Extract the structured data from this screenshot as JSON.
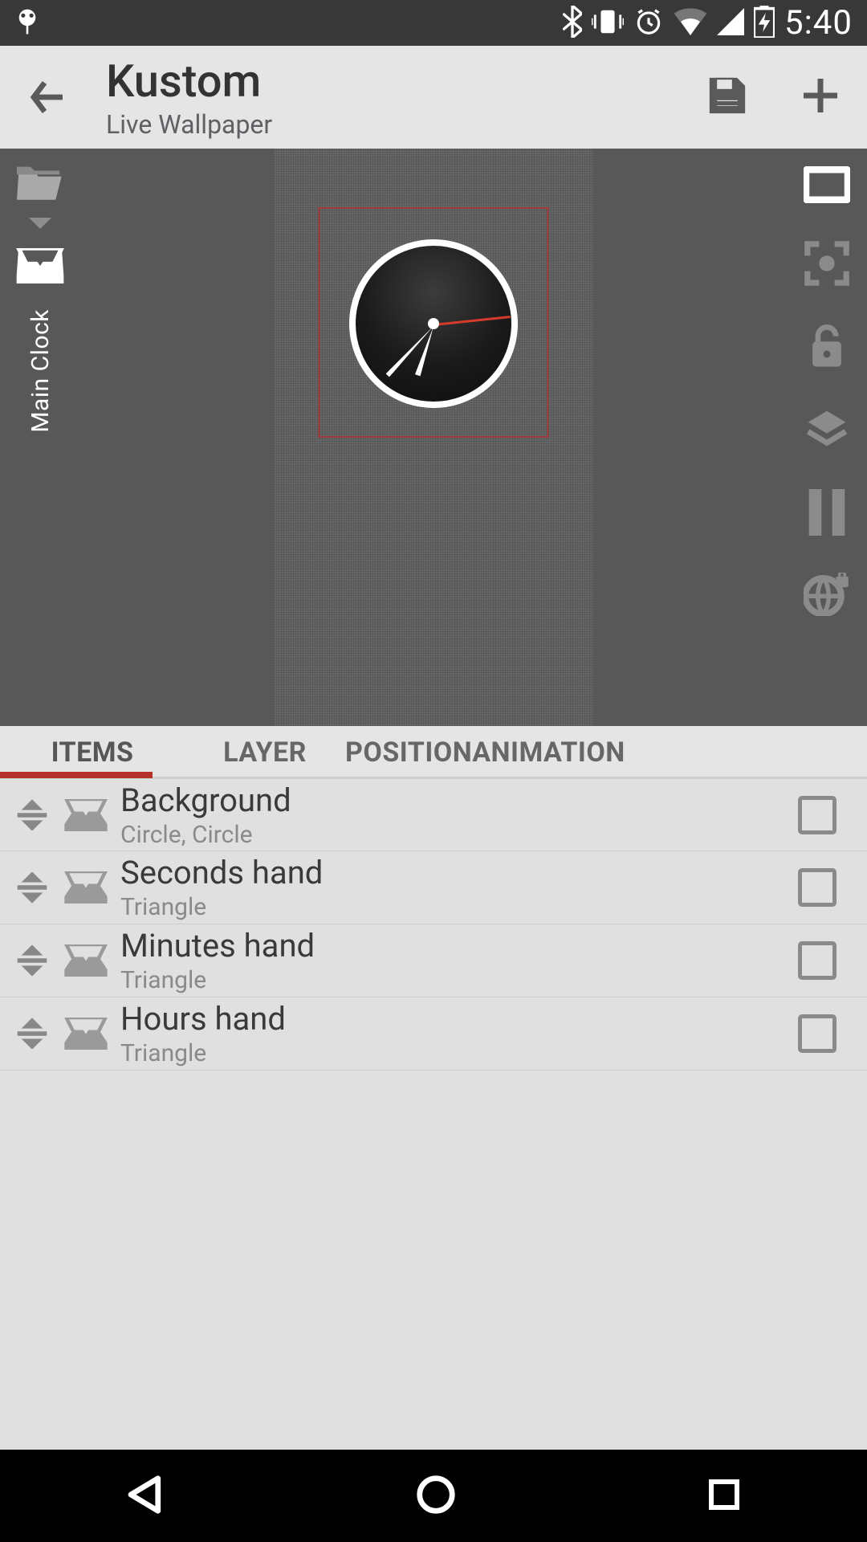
{
  "statusbar": {
    "time": "5:40"
  },
  "appbar": {
    "title": "Kustom",
    "subtitle": "Live Wallpaper"
  },
  "left_rail": {
    "label": "Main Clock"
  },
  "tabs": {
    "t0": "ITEMS",
    "t1": "LAYER",
    "t2": "POSITION",
    "t3": "ANIMATION",
    "active": 0
  },
  "items": [
    {
      "title": "Background",
      "sub": "Circle, Circle"
    },
    {
      "title": "Seconds hand",
      "sub": "Triangle"
    },
    {
      "title": "Minutes hand",
      "sub": "Triangle"
    },
    {
      "title": "Hours hand",
      "sub": "Triangle"
    }
  ]
}
